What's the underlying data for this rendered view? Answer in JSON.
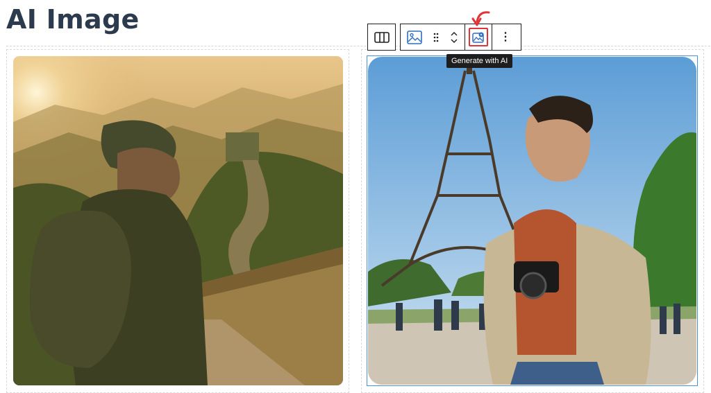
{
  "page": {
    "heading": "AI Image"
  },
  "toolbar": {
    "columns_icon": "columns-icon",
    "image_icon": "image-icon",
    "drag_icon": "drag-handle-icon",
    "move_up_icon": "chevron-up-icon",
    "move_down_icon": "chevron-down-icon",
    "ai_icon": "ai-image-icon",
    "more_icon": "more-options-icon",
    "more_label": "⋮",
    "highlight_color": "#e0343b"
  },
  "tooltip": {
    "text": "Generate with AI"
  },
  "images": {
    "left": {
      "icon": "great-wall-traveler-image"
    },
    "right": {
      "icon": "eiffel-tower-photographer-image",
      "selected_border_color": "#4a90d9"
    }
  }
}
